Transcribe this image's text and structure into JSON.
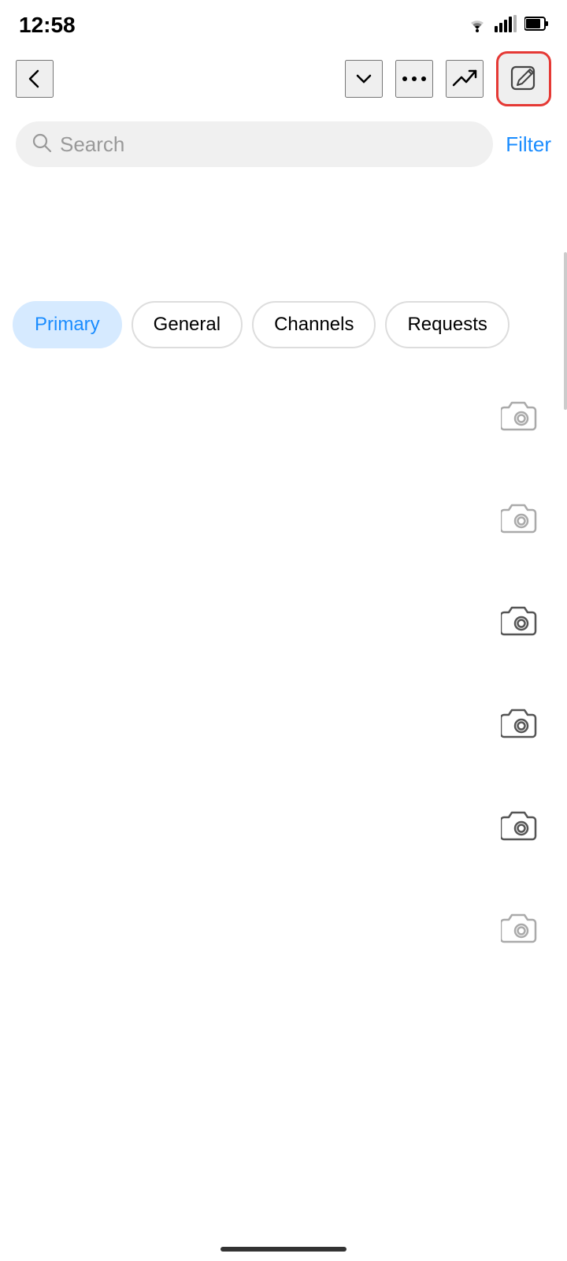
{
  "statusBar": {
    "time": "12:58"
  },
  "navBar": {
    "backLabel": "←",
    "dropdownLabel": "⌄",
    "moreLabel": "•••",
    "trendingLabel": "↗",
    "composeLabel": "compose"
  },
  "search": {
    "placeholder": "Search",
    "filterLabel": "Filter"
  },
  "tabs": [
    {
      "label": "Primary",
      "active": true
    },
    {
      "label": "General",
      "active": false
    },
    {
      "label": "Channels",
      "active": false
    },
    {
      "label": "Requests",
      "active": false
    }
  ],
  "cameraRows": [
    {
      "id": 1
    },
    {
      "id": 2
    },
    {
      "id": 3
    },
    {
      "id": 4
    },
    {
      "id": 5
    },
    {
      "id": 6
    }
  ],
  "colors": {
    "accent": "#1a8cff",
    "highlight": "#e53935",
    "tabActive": "#d6eaff"
  }
}
